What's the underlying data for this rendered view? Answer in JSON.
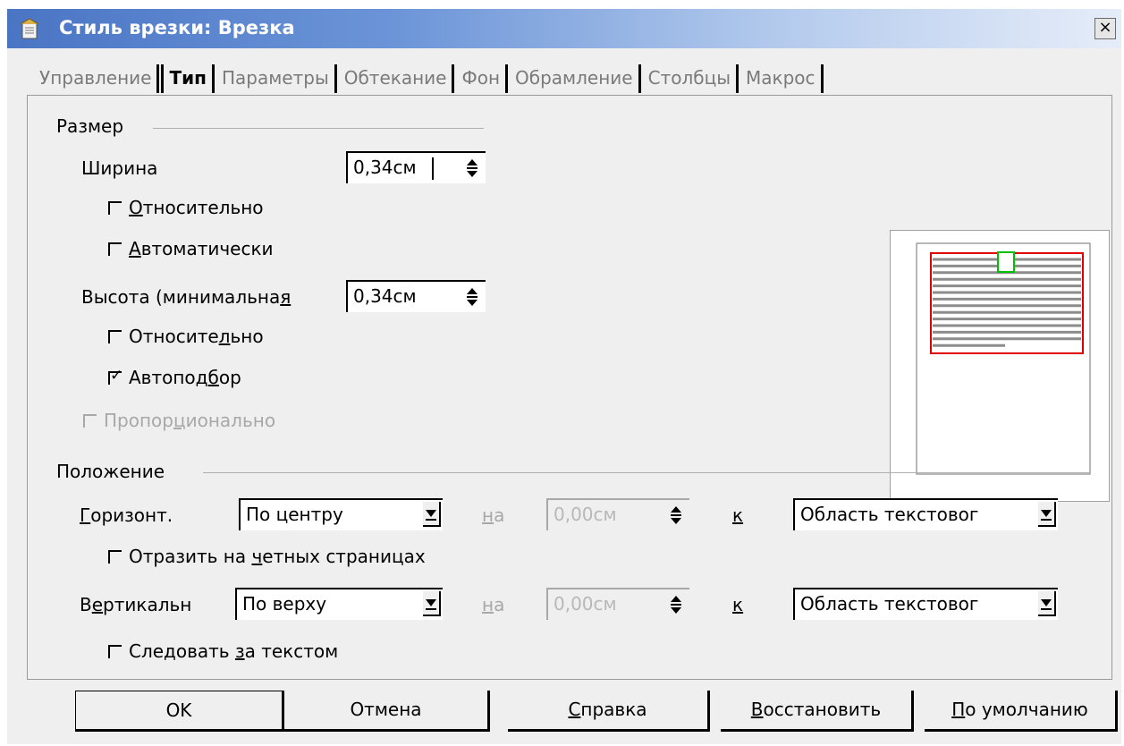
{
  "window": {
    "title": "Стиль врезки: Врезка",
    "close_label": "×",
    "title_icon": "frame-style-icon"
  },
  "tabs": [
    {
      "label": "Управление",
      "active": false
    },
    {
      "label": "Тип",
      "active": true
    },
    {
      "label": "Параметры",
      "active": false
    },
    {
      "label": "Обтекание",
      "active": false
    },
    {
      "label": "Фон",
      "active": false
    },
    {
      "label": "Обрамление",
      "active": false
    },
    {
      "label": "Столбцы",
      "active": false
    },
    {
      "label": "Макрос",
      "active": false
    }
  ],
  "size": {
    "section_title": "Размер",
    "width_label": "Ширина",
    "width_value": "0,34см",
    "width_relative_label": {
      "pre": "",
      "ul": "О",
      "post": "тносительно"
    },
    "width_relative_checked": false,
    "width_auto_label": {
      "pre": "",
      "ul": "А",
      "post": "втоматически"
    },
    "width_auto_checked": false,
    "height_label": {
      "pre": "Высота (минимальна",
      "ul": "я",
      "post": ""
    },
    "height_value": "0,34см",
    "height_relative_label": {
      "pre": "Относите",
      "ul": "л",
      "post": "ьно"
    },
    "height_relative_checked": false,
    "autofit_label": {
      "pre": "Автопод",
      "ul": "б",
      "post": "ор"
    },
    "autofit_checked": true,
    "proportional_label": {
      "pre": "Пропор",
      "ul": "ц",
      "post": "ионально"
    },
    "proportional_checked": false,
    "proportional_enabled": false
  },
  "position": {
    "section_title": "Положение",
    "horizontal_label": {
      "pre": "",
      "ul": "Г",
      "post": "оризонт."
    },
    "horizontal_value": "По центру",
    "horizontal_by_label": {
      "pre": "",
      "ul": "н",
      "post": "а"
    },
    "horizontal_by_value": "0,00см",
    "horizontal_to_label": "к",
    "horizontal_to_value": "Область текстовог",
    "mirror_label": {
      "pre": "Отразить на ",
      "ul": "ч",
      "post": "етных страницах"
    },
    "mirror_checked": false,
    "vertical_label": {
      "pre": "В",
      "ul": "е",
      "post": "ртикальн"
    },
    "vertical_value": "По верху",
    "vertical_by_label": {
      "pre": "",
      "ul": "н",
      "post": "а"
    },
    "vertical_by_value": "0,00см",
    "vertical_to_label": "к",
    "vertical_to_value": "Область текстовог",
    "follow_label": {
      "pre": "Следовать ",
      "ul": "з",
      "post": "а текстом"
    },
    "follow_checked": false
  },
  "buttons": {
    "ok": "OK",
    "cancel": "Отмена",
    "help": {
      "pre": "",
      "ul": "С",
      "post": "правка"
    },
    "reset": {
      "pre": "",
      "ul": "В",
      "post": "осстановить"
    },
    "default": {
      "pre": "",
      "ul": "П",
      "post": "о умолчанию"
    }
  },
  "colors": {
    "frame_border": "#e00000",
    "anchor_box": "#00c000",
    "text_lines": "#8c8c8c"
  }
}
